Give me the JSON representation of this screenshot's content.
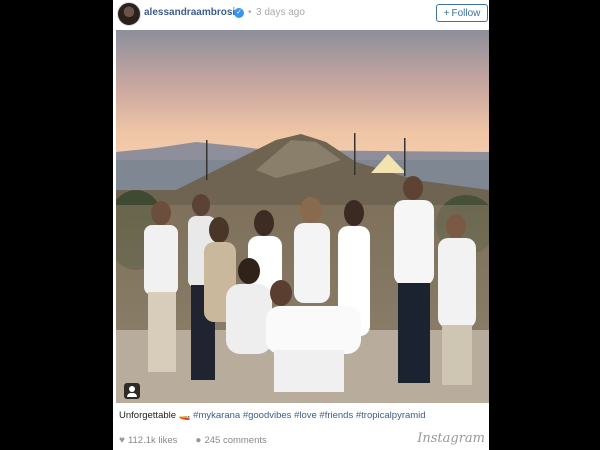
{
  "post": {
    "username": "alessandraambrosio",
    "separator": "•",
    "time": "3 days ago",
    "follow_label": "Follow",
    "follow_icon": "+",
    "verified_icon": "✓",
    "caption_text": "Unforgettable",
    "caption_emoji": "🚤",
    "hashtags": [
      "#mykarana",
      "#goodvibes",
      "#love",
      "#friends",
      "#tropicalpyramid"
    ],
    "likes": "112.1k likes",
    "comments": "245 comments",
    "heart_icon": "♥",
    "comment_icon": "●",
    "brand": "Instagram"
  },
  "colors": {
    "link": "#3d5d8a",
    "follow": "#3f729b",
    "verified": "#3897f0"
  }
}
